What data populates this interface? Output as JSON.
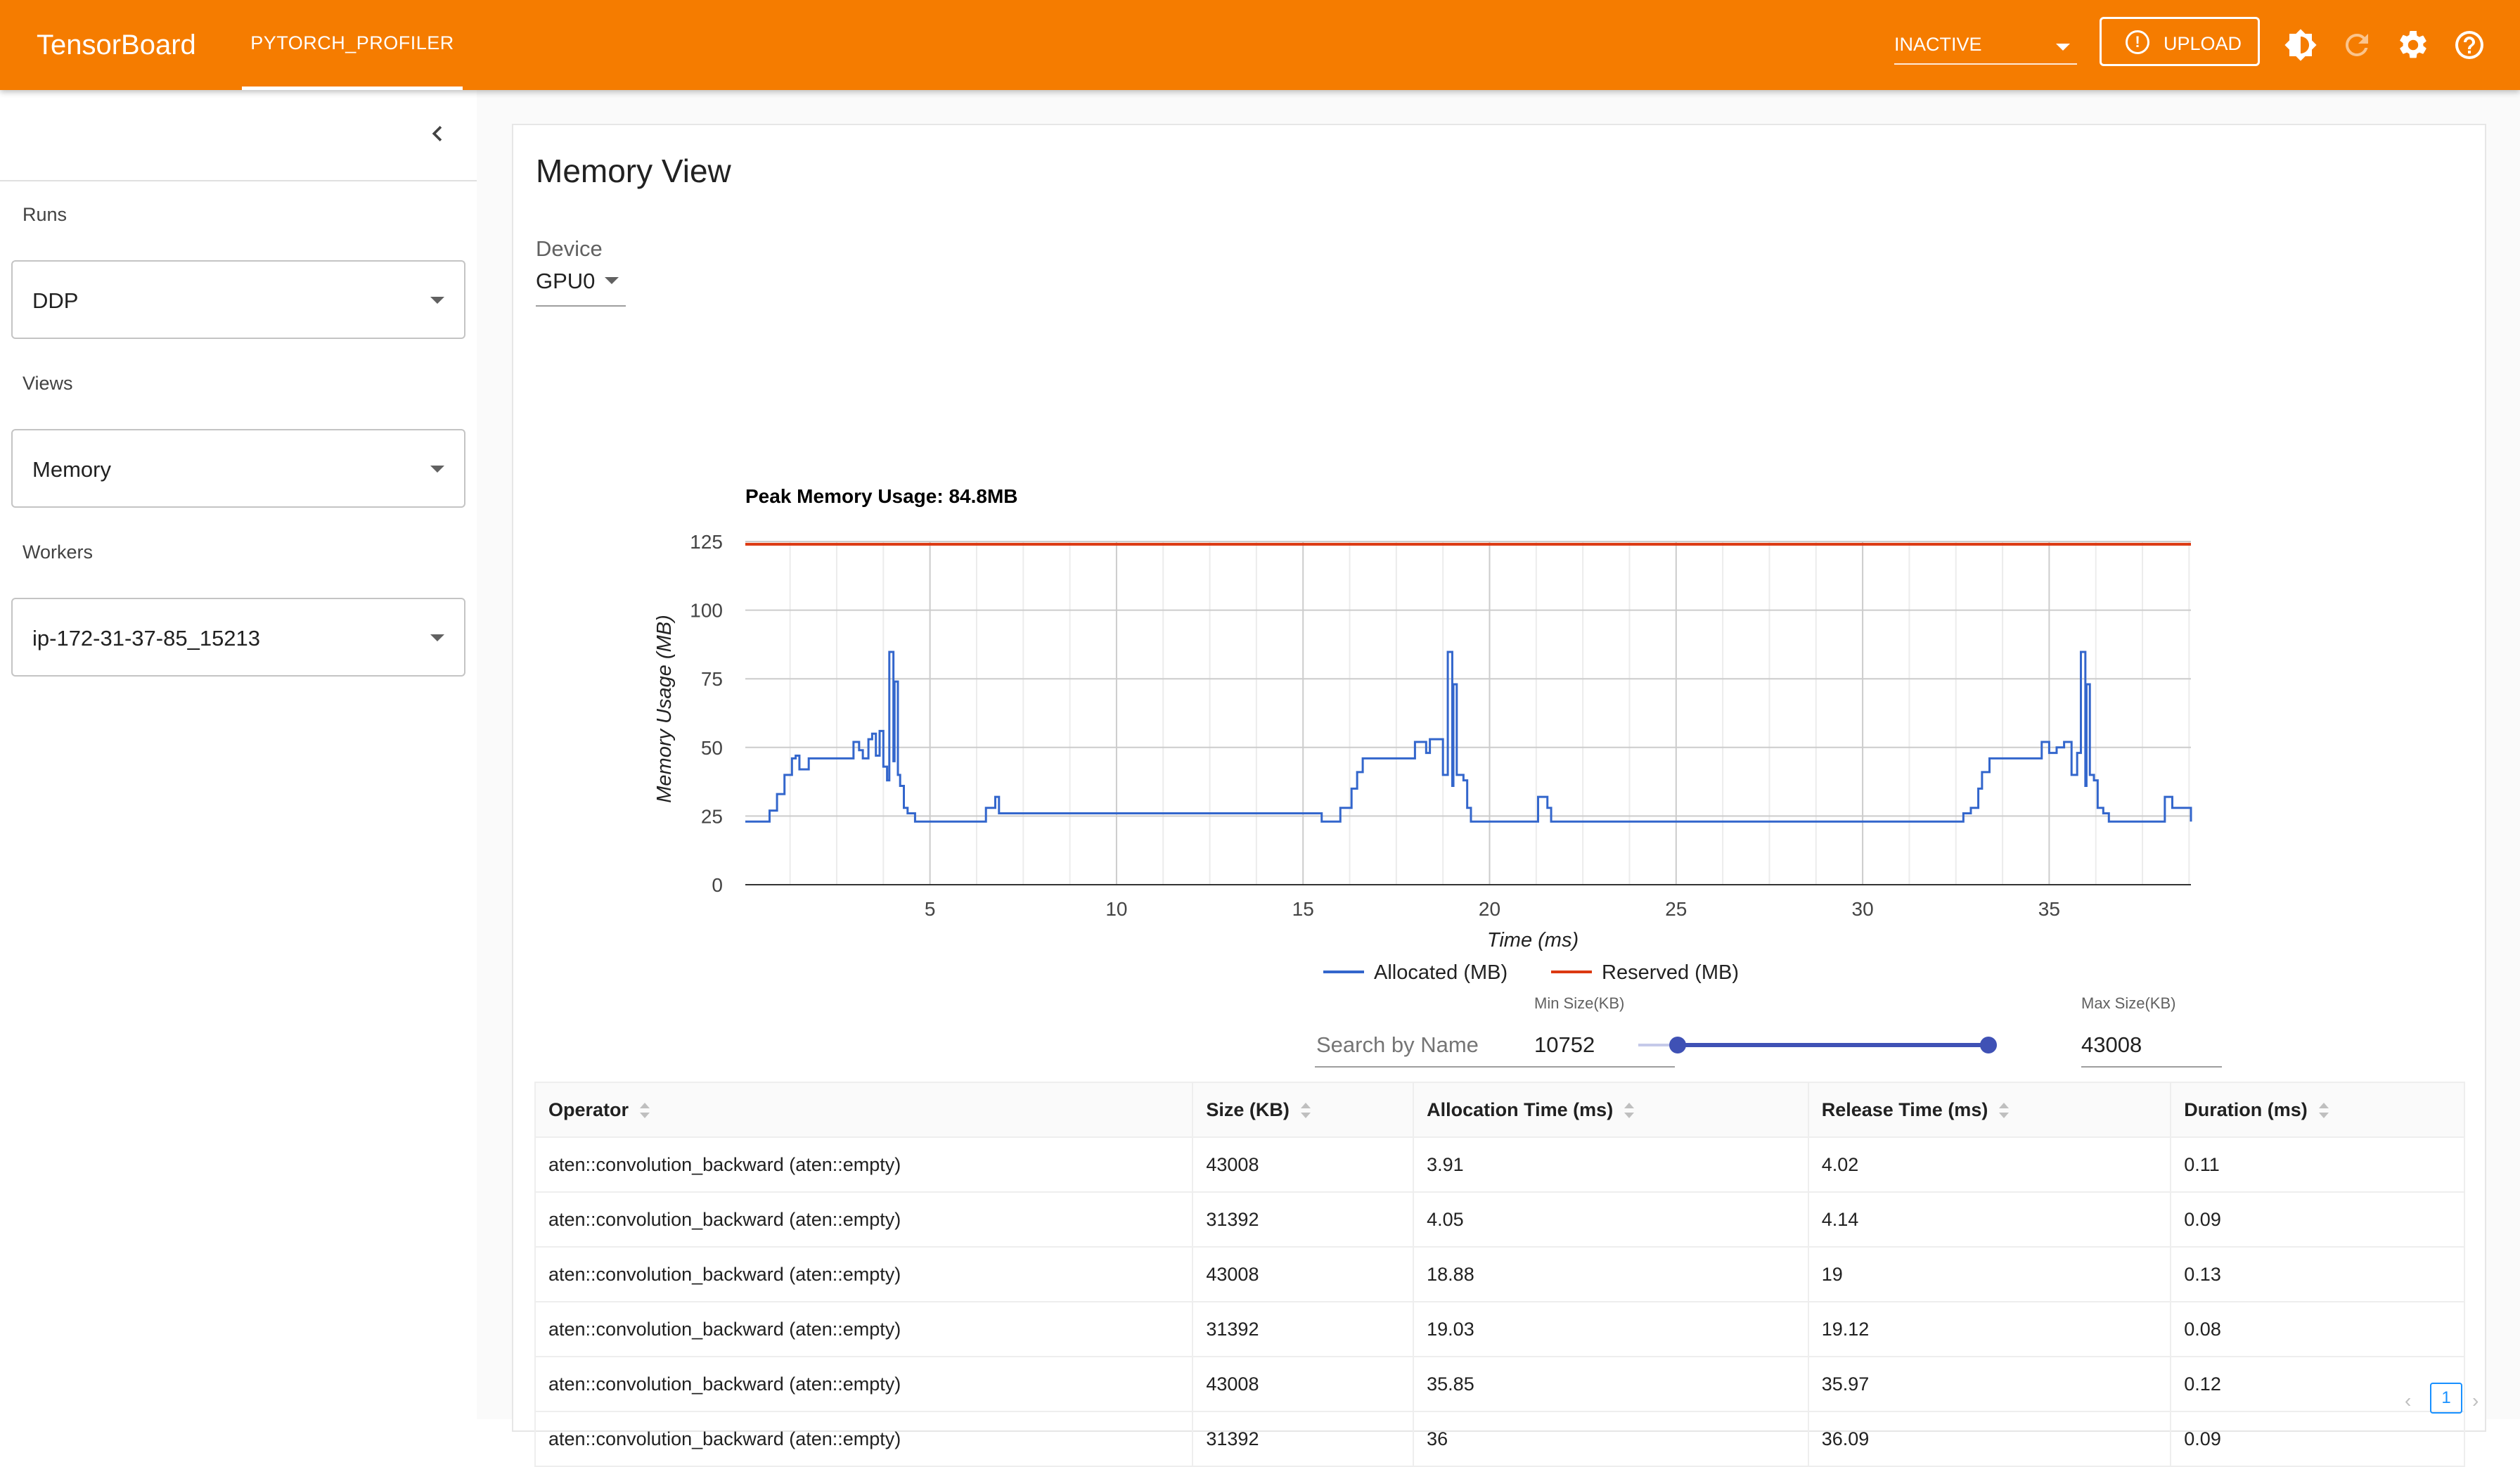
{
  "topbar": {
    "app_title": "TensorBoard",
    "plugin_tab": "PYTORCH_PROFILER",
    "status_select": "INACTIVE",
    "upload_label": "UPLOAD",
    "icons": [
      "upload-icon",
      "brightness-icon",
      "refresh-icon",
      "settings-icon",
      "help-icon"
    ],
    "colors": {
      "bar": "#f57c00",
      "text": "#ffffff"
    }
  },
  "sidebar": {
    "runs_label": "Runs",
    "runs_value": "DDP",
    "views_label": "Views",
    "views_value": "Memory",
    "workers_label": "Workers",
    "workers_value": "ip-172-31-37-85_15213"
  },
  "main": {
    "title": "Memory View",
    "device_label": "Device",
    "device_value": "GPU0"
  },
  "chart_data": {
    "type": "line",
    "title": "Peak Memory Usage: 84.8MB",
    "xlabel": "Time (ms)",
    "ylabel": "Memory Usage (MB)",
    "xlim": [
      0.05,
      38.8
    ],
    "ylim": [
      0,
      125
    ],
    "xticks": [
      5,
      10,
      15,
      20,
      25,
      30,
      35
    ],
    "yticks": [
      0,
      25,
      50,
      75,
      100,
      125
    ],
    "grid": true,
    "legend": "bottom-center",
    "series": [
      {
        "name": "Allocated (MB)",
        "color": "#3366cc",
        "step": true,
        "x": [
          0.05,
          0.7,
          0.9,
          1.1,
          1.3,
          1.4,
          1.5,
          1.75,
          2.8,
          2.95,
          3.1,
          3.2,
          3.35,
          3.45,
          3.55,
          3.65,
          3.75,
          3.85,
          3.91,
          4.02,
          4.05,
          4.14,
          4.2,
          4.3,
          4.4,
          4.6,
          4.8,
          6.4,
          6.5,
          6.75,
          6.85,
          15.5,
          15.7,
          16.0,
          16.3,
          16.45,
          16.6,
          16.8,
          17.5,
          18.0,
          18.2,
          18.3,
          18.4,
          18.6,
          18.75,
          18.88,
          19.0,
          19.03,
          19.12,
          19.3,
          19.4,
          19.5,
          19.6,
          21.2,
          21.3,
          21.55,
          21.65,
          32.5,
          32.7,
          32.9,
          33.1,
          33.2,
          33.4,
          33.6,
          34.4,
          34.8,
          34.9,
          35.0,
          35.2,
          35.4,
          35.6,
          35.75,
          35.85,
          35.97,
          36.0,
          36.09,
          36.2,
          36.3,
          36.45,
          36.6,
          37.9,
          38.1,
          38.3,
          38.8
        ],
        "y": [
          23,
          27,
          33,
          40,
          46,
          47,
          42,
          46,
          46,
          52,
          49,
          46,
          53,
          55,
          47,
          56,
          43,
          38,
          84.8,
          45,
          74,
          40,
          36,
          28,
          26,
          23,
          23,
          23,
          28,
          32,
          26,
          23,
          23,
          28,
          35,
          41,
          46,
          46,
          46,
          52,
          52,
          48,
          53,
          53,
          40,
          84.8,
          36,
          73,
          40,
          38,
          28,
          23,
          23,
          23,
          32,
          28,
          23,
          23,
          26,
          28,
          35,
          41,
          46,
          46,
          46,
          52,
          52,
          48,
          50,
          52,
          40,
          48,
          84.8,
          36,
          73,
          40,
          38,
          28,
          26,
          23,
          23,
          32,
          28,
          23
        ]
      },
      {
        "name": "Reserved (MB)",
        "color": "#dc3912",
        "x": [
          0.05,
          38.8
        ],
        "y": [
          124,
          124
        ]
      }
    ]
  },
  "filters": {
    "search_placeholder": "Search by Name",
    "search_value": "",
    "min_label": "Min Size(KB)",
    "min_value": "10752",
    "max_label": "Max Size(KB)",
    "max_value": "43008",
    "slider_min_fraction": 0.112,
    "slider_max_fraction": 0.996,
    "slider_color": "#3f51b5"
  },
  "table": {
    "columns": [
      "Operator",
      "Size (KB)",
      "Allocation Time (ms)",
      "Release Time (ms)",
      "Duration (ms)"
    ],
    "rows": [
      [
        "aten::convolution_backward (aten::empty)",
        "43008",
        "3.91",
        "4.02",
        "0.11"
      ],
      [
        "aten::convolution_backward (aten::empty)",
        "31392",
        "4.05",
        "4.14",
        "0.09"
      ],
      [
        "aten::convolution_backward (aten::empty)",
        "43008",
        "18.88",
        "19",
        "0.13"
      ],
      [
        "aten::convolution_backward (aten::empty)",
        "31392",
        "19.03",
        "19.12",
        "0.08"
      ],
      [
        "aten::convolution_backward (aten::empty)",
        "43008",
        "35.85",
        "35.97",
        "0.12"
      ],
      [
        "aten::convolution_backward (aten::empty)",
        "31392",
        "36",
        "36.09",
        "0.09"
      ]
    ]
  },
  "pagination": {
    "current_page": "1",
    "prev_icon": "chevron-left-icon",
    "next_icon": "chevron-right-icon"
  }
}
